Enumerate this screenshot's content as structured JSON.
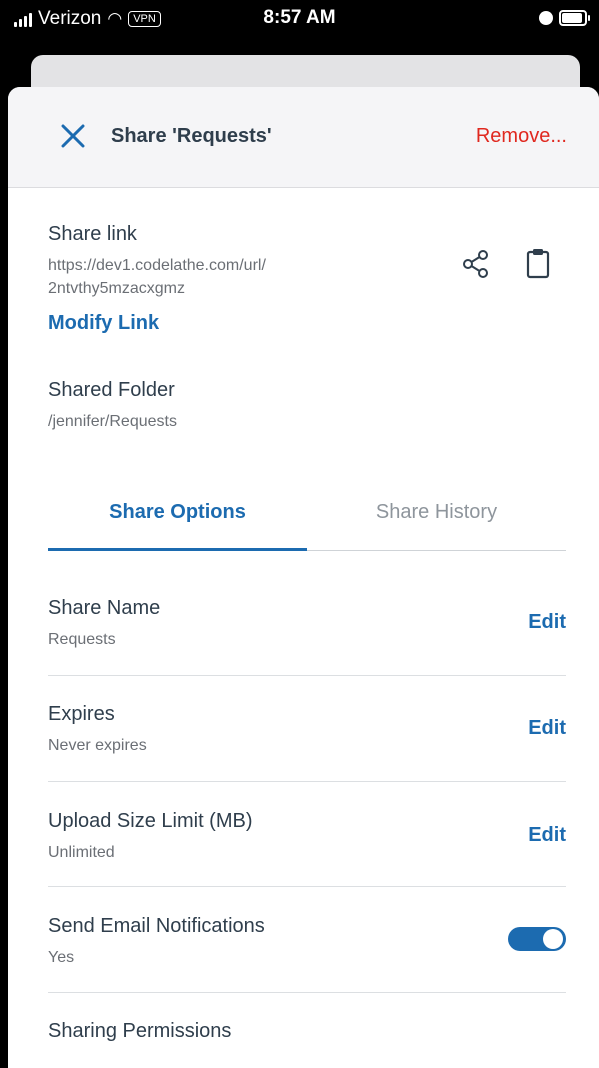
{
  "status_bar": {
    "carrier": "Verizon",
    "vpn": "VPN",
    "time": "8:57 AM"
  },
  "header": {
    "title": "Share 'Requests'",
    "remove_label": "Remove..."
  },
  "share_link": {
    "label": "Share link",
    "url_line1": "https://dev1.codelathe.com/url/",
    "url_line2": "2ntvthy5mzacxgmz",
    "modify_label": "Modify Link"
  },
  "shared_folder": {
    "label": "Shared Folder",
    "path": "/jennifer/Requests"
  },
  "tabs": [
    {
      "label": "Share Options",
      "active": true
    },
    {
      "label": "Share History",
      "active": false
    }
  ],
  "options": {
    "share_name": {
      "label": "Share Name",
      "value": "Requests",
      "action": "Edit"
    },
    "expires": {
      "label": "Expires",
      "value": "Never expires",
      "action": "Edit"
    },
    "upload_limit": {
      "label": "Upload Size Limit (MB)",
      "value": "Unlimited",
      "action": "Edit"
    },
    "email_notifications": {
      "label": "Send Email Notifications",
      "value": "Yes",
      "enabled": true
    },
    "permissions": {
      "label": "Sharing Permissions"
    }
  },
  "colors": {
    "accent": "#1c6bb0",
    "danger": "#e0281f",
    "text": "#2f3e4c",
    "muted": "#6b6f75"
  }
}
